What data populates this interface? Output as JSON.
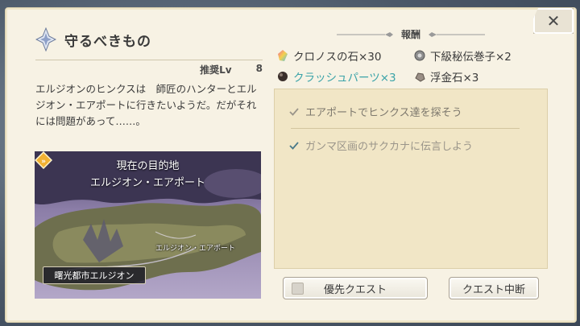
{
  "quest": {
    "title": "守るべきもの",
    "recommended_label": "推奨Lv",
    "recommended_value": "8",
    "description": "エルジオンのヒンクスは　師匠のハンターとエルジオン・エアポートに行きたいようだ。だがそれには問題があって……。"
  },
  "map": {
    "heading_line1": "現在の目的地",
    "heading_line2": "エルジオン・エアポート",
    "marker_label": "エルジオン・エアポート",
    "city_badge": "曙光都市エルジオン"
  },
  "rewards": {
    "title": "報酬",
    "items": [
      {
        "label": "クロノスの石×30",
        "icon": "rainbow-crystal-icon",
        "highlight": false
      },
      {
        "label": "下級秘伝巻子×2",
        "icon": "scroll-gear-icon",
        "highlight": false
      },
      {
        "label": "クラッシュパーツ×3",
        "icon": "dark-orb-icon",
        "highlight": true
      },
      {
        "label": "浮金石×3",
        "icon": "ore-icon",
        "highlight": false
      }
    ]
  },
  "objectives": [
    {
      "label": "エアポートでヒンクス達を探そう"
    },
    {
      "label": "ガンマ区画のサクカナに伝言しよう"
    }
  ],
  "buttons": {
    "priority": "優先クエスト",
    "abort": "クエスト中断",
    "close": "✕"
  },
  "colors": {
    "panel": "#f7f2e4",
    "objectives_bg": "#f1e6c6",
    "highlight_text": "#3aa3a8",
    "check": "#4a7a8a"
  }
}
